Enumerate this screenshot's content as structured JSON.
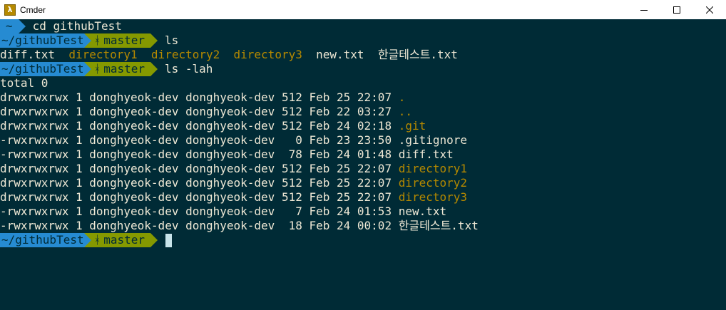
{
  "window": {
    "title": "Cmder",
    "icon": "lambda-icon",
    "icon_glyph": "λ",
    "minimize_glyph": "—",
    "maximize_glyph": "☐",
    "close_glyph": "✕"
  },
  "colors": {
    "background": "#002b36",
    "path_segment": "#268bd2",
    "git_segment": "#859900",
    "directory": "#b58900",
    "text": "#eee8d5",
    "cursor": "#c8e4ea"
  },
  "prompt": {
    "home_path": "~",
    "repo_path": "~/githubTest",
    "branch_icon": "git-branch-icon",
    "branch_glyph": "ᚼ",
    "branch": "master"
  },
  "commands": {
    "cd": "cd githubTest",
    "ls": "ls",
    "ls_lah": "ls -lah"
  },
  "ls_output": [
    {
      "name": "diff.txt",
      "type": "file"
    },
    {
      "name": "directory1",
      "type": "dir"
    },
    {
      "name": "directory2",
      "type": "dir"
    },
    {
      "name": "directory3",
      "type": "dir"
    },
    {
      "name": "new.txt",
      "type": "file"
    },
    {
      "name": "한글테스트.txt",
      "type": "file"
    }
  ],
  "ls_lah_total": "total 0",
  "ls_lah_rows": [
    {
      "info": "drwxrwxrwx 1 donghyeok-dev donghyeok-dev 512 Feb 25 22:07 ",
      "name": ".",
      "type": "dir"
    },
    {
      "info": "drwxrwxrwx 1 donghyeok-dev donghyeok-dev 512 Feb 22 03:27 ",
      "name": "..",
      "type": "dir"
    },
    {
      "info": "drwxrwxrwx 1 donghyeok-dev donghyeok-dev 512 Feb 24 02:18 ",
      "name": ".git",
      "type": "dir"
    },
    {
      "info": "-rwxrwxrwx 1 donghyeok-dev donghyeok-dev   0 Feb 23 23:50 ",
      "name": ".gitignore",
      "type": "file"
    },
    {
      "info": "-rwxrwxrwx 1 donghyeok-dev donghyeok-dev  78 Feb 24 01:48 ",
      "name": "diff.txt",
      "type": "file"
    },
    {
      "info": "drwxrwxrwx 1 donghyeok-dev donghyeok-dev 512 Feb 25 22:07 ",
      "name": "directory1",
      "type": "dir"
    },
    {
      "info": "drwxrwxrwx 1 donghyeok-dev donghyeok-dev 512 Feb 25 22:07 ",
      "name": "directory2",
      "type": "dir"
    },
    {
      "info": "drwxrwxrwx 1 donghyeok-dev donghyeok-dev 512 Feb 25 22:07 ",
      "name": "directory3",
      "type": "dir"
    },
    {
      "info": "-rwxrwxrwx 1 donghyeok-dev donghyeok-dev   7 Feb 24 01:53 ",
      "name": "new.txt",
      "type": "file"
    },
    {
      "info": "-rwxrwxrwx 1 donghyeok-dev donghyeok-dev  18 Feb 24 00:02 ",
      "name": "한글테스트.txt",
      "type": "file"
    }
  ]
}
